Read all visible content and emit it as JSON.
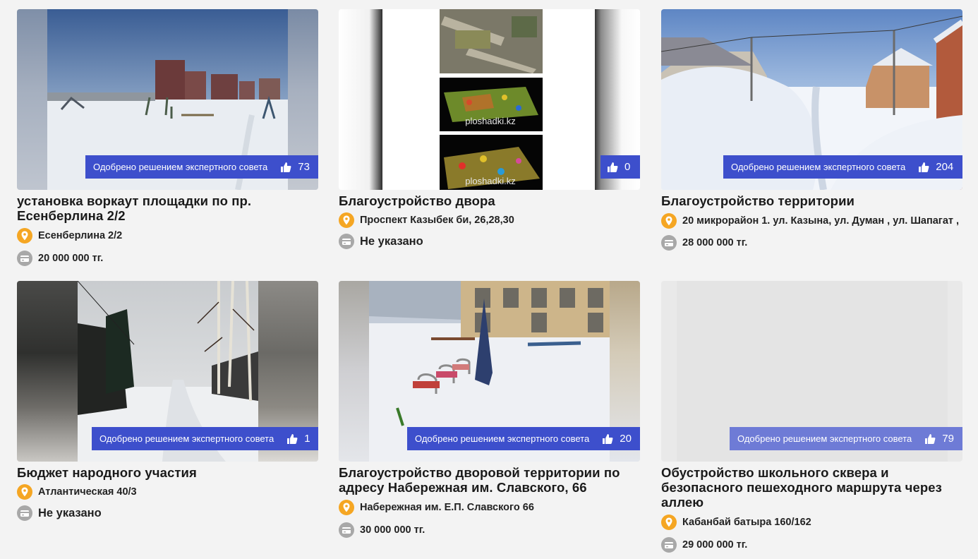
{
  "approved_label": "Одобрено решением экспертного совета",
  "projects": [
    {
      "title": "установка воркаут площадки по пр. Есенберлина 2/2",
      "address": "Есенберлина 2/2",
      "budget": "20 000 000 тг.",
      "likes": "73",
      "approved": true
    },
    {
      "title": "Благоустройство двора",
      "address": "Проспект Казыбек би, 26,28,30",
      "budget": "Не указано",
      "likes": "0",
      "approved": false,
      "image_caption": "ploshadki.kz"
    },
    {
      "title": "Благоустройство территории",
      "address": "20 микрорайон 1. ул. Казына, ул. Думан , ул. Шапагат ,",
      "budget": "28 000 000 тг.",
      "likes": "204",
      "approved": true
    },
    {
      "title": "Бюджет народного участия",
      "address": "Атлантическая 40/3",
      "budget": "Не указано",
      "likes": "1",
      "approved": true
    },
    {
      "title": "Благоустройство дворовой территории по адресу Набережная им. Славского, 66",
      "address": "Набережная им. Е.П. Славского 66",
      "budget": "30 000 000 тг.",
      "likes": "20",
      "approved": true
    },
    {
      "title": "Обустройство школьного сквера и безопасного пешеходного маршрута через аллею",
      "address": "Кабанбай батыра 160/162",
      "budget": "29 000 000 тг.",
      "likes": "79",
      "approved": true
    }
  ],
  "icons": {
    "location": "location-pin-icon",
    "budget": "credit-card-icon",
    "likes": "thumbs-up-icon"
  },
  "colors": {
    "badge": "#3d4fcc",
    "pin": "#f5a623",
    "card_icon": "#a8a8a8",
    "background": "#f3f3f3"
  }
}
